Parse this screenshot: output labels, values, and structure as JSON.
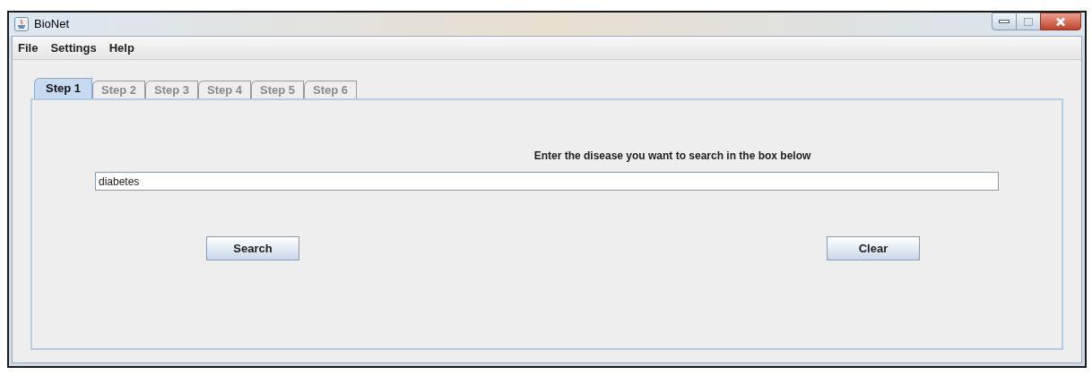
{
  "window": {
    "title": "BioNet"
  },
  "menu": [
    "File",
    "Settings",
    "Help"
  ],
  "tabs": [
    {
      "label": "Step 1",
      "selected": true
    },
    {
      "label": "Step 2",
      "selected": false
    },
    {
      "label": "Step 3",
      "selected": false
    },
    {
      "label": "Step 4",
      "selected": false
    },
    {
      "label": "Step 5",
      "selected": false
    },
    {
      "label": "Step 6",
      "selected": false
    }
  ],
  "prompt": "Enter the disease you want to search in the box below",
  "search_field": {
    "value": "diabetes"
  },
  "buttons": [
    "Search",
    "Clear"
  ]
}
